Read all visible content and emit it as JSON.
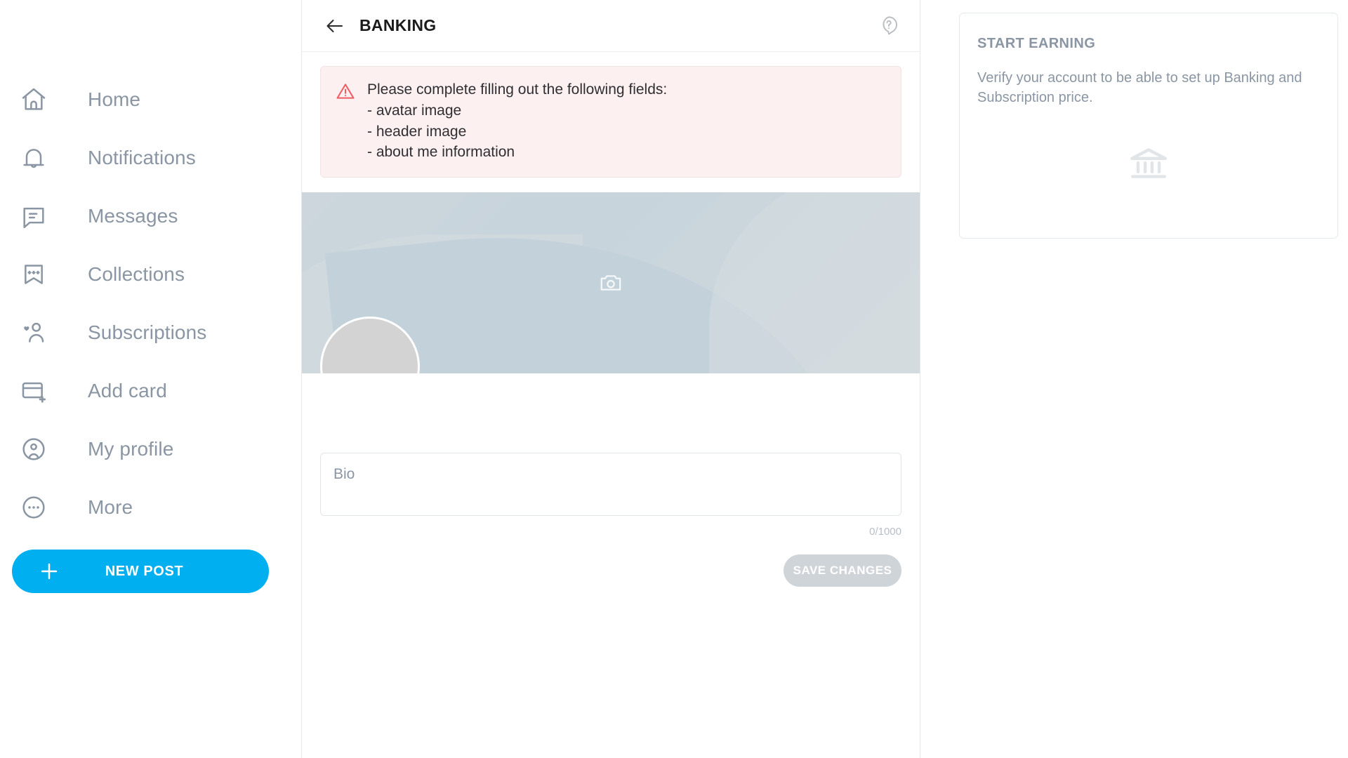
{
  "colors": {
    "accent": "#00aff0",
    "nav_text": "#8a96a3",
    "alert_bg": "#fdf0f1",
    "alert_icon": "#f05b62",
    "banner_base": "#ccd6dc",
    "avatar_fill": "#d3d3d3",
    "save_button_bg": "#cfd4d9"
  },
  "sidebar": {
    "items": [
      {
        "label": "Home",
        "icon": "home-icon"
      },
      {
        "label": "Notifications",
        "icon": "bell-icon"
      },
      {
        "label": "Messages",
        "icon": "message-icon"
      },
      {
        "label": "Collections",
        "icon": "bookmark-stars-icon"
      },
      {
        "label": "Subscriptions",
        "icon": "person-heart-icon"
      },
      {
        "label": "Add card",
        "icon": "credit-card-plus-icon"
      },
      {
        "label": "My profile",
        "icon": "user-circle-icon"
      },
      {
        "label": "More",
        "icon": "ellipsis-circle-icon"
      }
    ],
    "new_post_label": "NEW POST",
    "new_post_icon": "plus-icon"
  },
  "center": {
    "header": {
      "back_icon": "arrow-left-icon",
      "title": "BANKING",
      "help_icon": "help-question-icon"
    },
    "alert": {
      "icon": "warning-triangle-icon",
      "title": "Please complete filling out the following fields:",
      "lines": [
        "- avatar image",
        "- header image",
        "- about me information"
      ]
    },
    "banner": {
      "camera_icon": "camera-icon",
      "avatar_icon": "avatar"
    },
    "bio": {
      "placeholder": "Bio",
      "value": "",
      "counter": "0/1000"
    },
    "save_label": "SAVE CHANGES"
  },
  "right": {
    "earn_card": {
      "title": "START EARNING",
      "text": "Verify your account to be able to set up Banking and Subscription price.",
      "icon": "bank-icon"
    }
  }
}
